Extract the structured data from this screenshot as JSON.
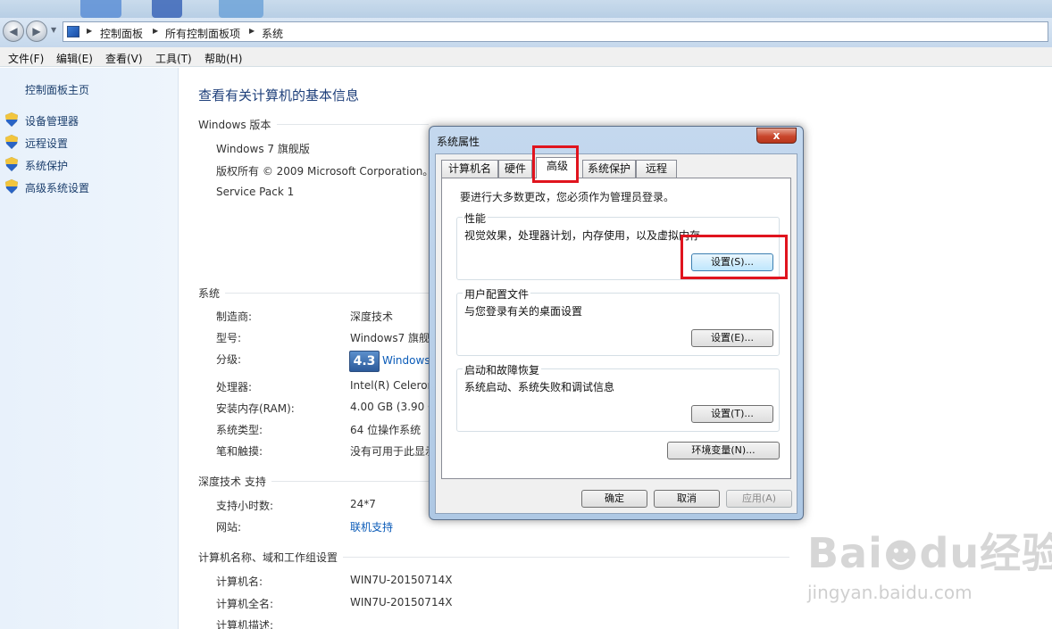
{
  "explorer": {
    "breadcrumbs": [
      "控制面板",
      "所有控制面板项",
      "系统"
    ],
    "menu": [
      "文件(F)",
      "编辑(E)",
      "查看(V)",
      "工具(T)",
      "帮助(H)"
    ]
  },
  "left_pane": {
    "home": "控制面板主页",
    "links": [
      "设备管理器",
      "远程设置",
      "系统保护",
      "高级系统设置"
    ]
  },
  "main": {
    "title": "查看有关计算机的基本信息",
    "windows_edition": {
      "heading": "Windows 版本",
      "edition": "Windows 7 旗舰版",
      "copyright": "版权所有 © 2009 Microsoft Corporation。",
      "service_pack": "Service Pack 1"
    },
    "system": {
      "heading": "系统",
      "rows": [
        {
          "label": "制造商:",
          "value": "深度技术"
        },
        {
          "label": "型号:",
          "value": "Windows7 旗舰版"
        },
        {
          "label": "分级:",
          "value": "Windows"
        },
        {
          "label": "处理器:",
          "value": "Intel(R) Celeron"
        },
        {
          "label": "安装内存(RAM):",
          "value": "4.00 GB (3.90 G"
        },
        {
          "label": "系统类型:",
          "value": "64 位操作系统"
        },
        {
          "label": "笔和触摸:",
          "value": "没有可用于此显示"
        }
      ],
      "rating": "4.3"
    },
    "support": {
      "heading": "深度技术 支持",
      "rows": [
        {
          "label": "支持小时数:",
          "value": "24*7"
        },
        {
          "label": "网站:",
          "value": "联机支持"
        }
      ]
    },
    "computer_name": {
      "heading": "计算机名称、域和工作组设置",
      "rows": [
        {
          "label": "计算机名:",
          "value": "WIN7U-20150714X"
        },
        {
          "label": "计算机全名:",
          "value": "WIN7U-20150714X"
        },
        {
          "label": "计算机描述:",
          "value": ""
        }
      ]
    }
  },
  "dialog": {
    "title": "系统属性",
    "close": "x",
    "tabs": [
      "计算机名",
      "硬件",
      "高级",
      "系统保护",
      "远程"
    ],
    "admin_note": "要进行大多数更改，您必须作为管理员登录。",
    "groups": [
      {
        "title": "性能",
        "desc": "视觉效果，处理器计划，内存使用，以及虚拟内存",
        "button": "设置(S)..."
      },
      {
        "title": "用户配置文件",
        "desc": "与您登录有关的桌面设置",
        "button": "设置(E)..."
      },
      {
        "title": "启动和故障恢复",
        "desc": "系统启动、系统失败和调试信息",
        "button": "设置(T)..."
      }
    ],
    "env_button": "环境变量(N)...",
    "ok": "确定",
    "cancel": "取消",
    "apply": "应用(A)"
  },
  "watermark": {
    "logo": "Baidu经验",
    "url": "jingyan.baidu.com"
  },
  "colors": {
    "highlight": "#e0141e",
    "link": "#0a5bb8",
    "title": "#1e3f7a"
  }
}
